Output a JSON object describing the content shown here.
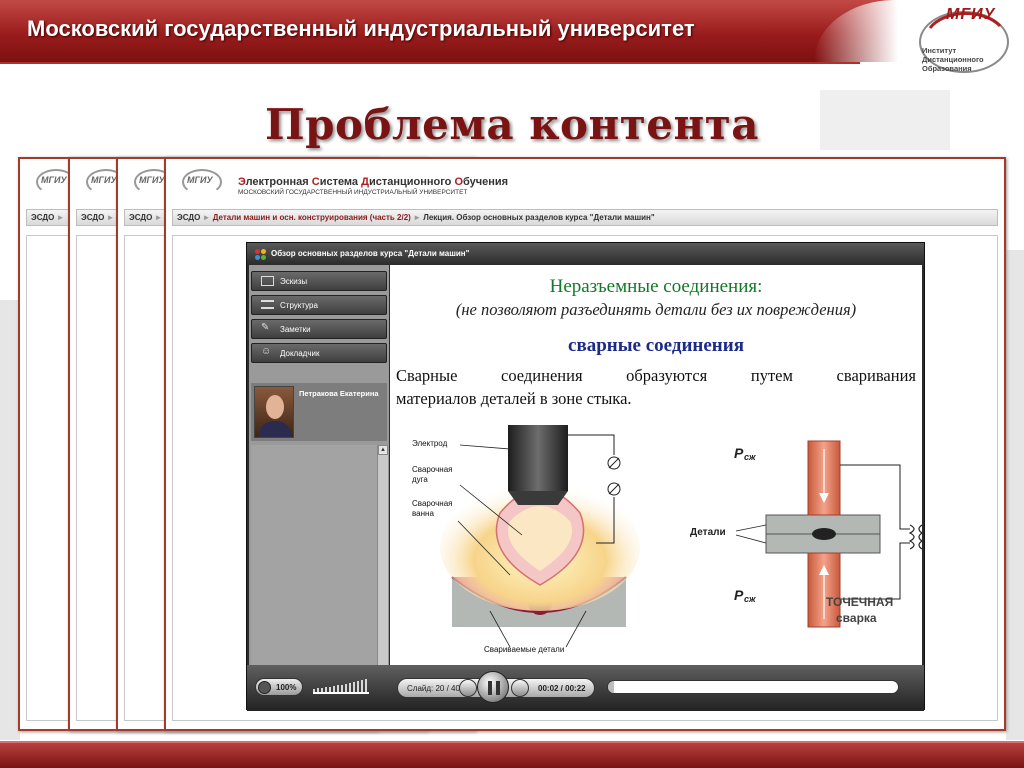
{
  "header": {
    "title": "Московский государственный индустриальный университет",
    "logo_mark": "МГИУ",
    "logo_lines": [
      "Институт",
      "Дистанционного",
      "Образования"
    ]
  },
  "slide_title": "Проблема контента",
  "window": {
    "system_name_parts": [
      "Э",
      "лектронная ",
      "С",
      "истема ",
      "Д",
      "истанционного ",
      "О",
      "бучения"
    ],
    "system_subtitle": "МОСКОВСКИЙ ГОСУДАРСТВЕННЫЙ ИНДУСТРИАЛЬНЫЙ УНИВЕРСИТЕТ",
    "mini_logo_mark": "МГИУ",
    "breadcrumb": {
      "root": "ЭСДО",
      "course": "Детали машин и осн. конструирования (часть 2/2)",
      "lecture": "Лекция. Обзор основных разделов курса \"Детали машин\""
    }
  },
  "player": {
    "title": "Обзор основных разделов курса \"Детали машин\"",
    "sidebar_buttons": [
      "Эскизы",
      "Структура",
      "Заметки",
      "Докладчик"
    ],
    "speaker_name": "Петракова Екатерина",
    "slide": {
      "heading": "Неразъемные соединения:",
      "subheading": "(не позволяют разъединять детали без их повреждения)",
      "section": "сварные соединения",
      "text_line1": "Сварные соединения образуются путем сваривания",
      "text_line2": "материалов деталей в зоне стыка.",
      "arc_labels": [
        "Электрод",
        "Сварочная",
        "дуга",
        "Сварочная",
        "ванна",
        "Свариваемые детали"
      ],
      "spot_labels": {
        "force_top": "P",
        "force_sub": "сж",
        "force_bottom": "P",
        "force_bottom_sub": "сж",
        "parts": "Детали",
        "spot_title1": "ТОЧЕЧНАЯ",
        "spot_title2": "сварка"
      }
    },
    "controls": {
      "volume": "100%",
      "slide_counter": "Слайд: 20 / 40",
      "time": "00:02 / 00:22",
      "progress_fraction": 0.02
    }
  }
}
